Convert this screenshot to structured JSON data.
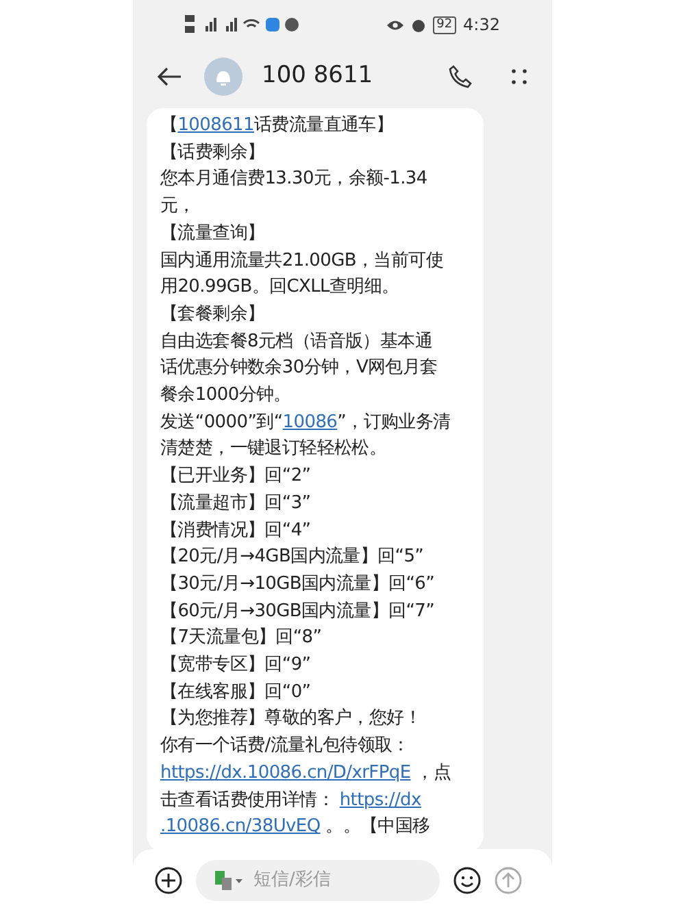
{
  "status_bar": {
    "battery": "92",
    "time": "4:32"
  },
  "header": {
    "contact": "100 8611"
  },
  "message": {
    "lines": [
      [
        {
          "kind": "text",
          "text": "【"
        },
        {
          "kind": "link",
          "text": "1008611"
        },
        {
          "kind": "text",
          "text": "话费流量直通车】"
        }
      ],
      [
        {
          "kind": "text",
          "text": "【话费剩余】"
        }
      ],
      [
        {
          "kind": "text",
          "text": "您本月通信费13.30元，余额-1.34"
        }
      ],
      [
        {
          "kind": "text",
          "text": "元，"
        }
      ],
      [
        {
          "kind": "text",
          "text": "【流量查询】"
        }
      ],
      [
        {
          "kind": "text",
          "text": "国内通用流量共21.00GB，当前可使"
        }
      ],
      [
        {
          "kind": "text",
          "text": "用20.99GB。回CXLL查明细。"
        }
      ],
      [
        {
          "kind": "text",
          "text": "【套餐剩余】"
        }
      ],
      [
        {
          "kind": "text",
          "text": "自由选套餐8元档（语音版）基本通"
        }
      ],
      [
        {
          "kind": "text",
          "text": "话优惠分钟数余30分钟，V网包月套"
        }
      ],
      [
        {
          "kind": "text",
          "text": "餐余1000分钟。"
        }
      ],
      [
        {
          "kind": "text",
          "text": "发送“0000”到“"
        },
        {
          "kind": "link",
          "text": "10086"
        },
        {
          "kind": "text",
          "text": "”，订购业务清"
        }
      ],
      [
        {
          "kind": "text",
          "text": "清楚楚，一键退订轻轻松松。"
        }
      ],
      [
        {
          "kind": "text",
          "text": "【已开业务】回“2”"
        }
      ],
      [
        {
          "kind": "text",
          "text": "【流量超市】回“3”"
        }
      ],
      [
        {
          "kind": "text",
          "text": "【消费情况】回“4”"
        }
      ],
      [
        {
          "kind": "text",
          "text": "【20元/月→4GB国内流量】回“5”"
        }
      ],
      [
        {
          "kind": "text",
          "text": "【30元/月→10GB国内流量】回“6”"
        }
      ],
      [
        {
          "kind": "text",
          "text": "【60元/月→30GB国内流量】回“7”"
        }
      ],
      [
        {
          "kind": "text",
          "text": "【7天流量包】回“8”"
        }
      ],
      [
        {
          "kind": "text",
          "text": "【宽带专区】回“9”"
        }
      ],
      [
        {
          "kind": "text",
          "text": "【在线客服】回“0”"
        }
      ],
      [
        {
          "kind": "text",
          "text": "【为您推荐】尊敬的客户，您好！"
        }
      ],
      [
        {
          "kind": "text",
          "text": "你有一个话费/流量礼包待领取："
        }
      ],
      [
        {
          "kind": "link",
          "text": "https://dx.10086.cn/D/xrFPqE"
        },
        {
          "kind": "text",
          "text": " ，点"
        }
      ],
      [
        {
          "kind": "text",
          "text": "击查看话费使用详情： "
        },
        {
          "kind": "link",
          "text": "https://dx"
        }
      ],
      [
        {
          "kind": "link",
          "text": ".10086.cn/38UvEQ"
        },
        {
          "kind": "text",
          "text": " 。。【中国移"
        }
      ]
    ]
  },
  "composer": {
    "placeholder": "短信/彩信"
  }
}
